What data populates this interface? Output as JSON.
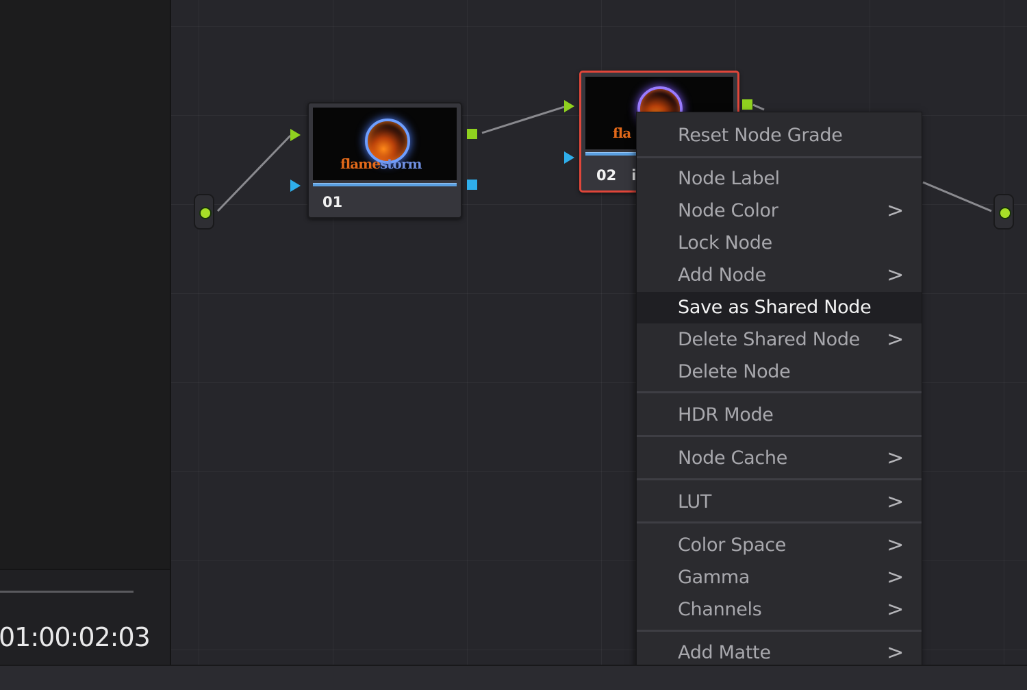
{
  "viewer": {
    "timecode": "01:00:02:03"
  },
  "nodes": [
    {
      "id": "node-01",
      "label": "01",
      "thumbnail": "flamestorm",
      "selected": false
    },
    {
      "id": "node-02",
      "label": "02",
      "thumbnail": "flamestorm",
      "selected": true,
      "label_extra": "i"
    }
  ],
  "thumbnail_text": {
    "part_a": "flame",
    "part_b": "storm",
    "partial": "fla"
  },
  "colors": {
    "accent_selected": "#e0463a",
    "port_green": "#8fd11f",
    "port_blue": "#2faeea",
    "menu_bg": "#2b2b2f",
    "menu_text": "#a8a8ad",
    "menu_highlight_text": "#f4f4f4"
  },
  "context_menu": {
    "items": [
      {
        "label": "Reset Node Grade",
        "submenu": false
      },
      {
        "label": "Node Label",
        "submenu": false
      },
      {
        "label": "Node Color",
        "submenu": true
      },
      {
        "label": "Lock Node",
        "submenu": false
      },
      {
        "label": "Add Node",
        "submenu": true
      },
      {
        "label": "Save as Shared Node",
        "submenu": false,
        "highlighted": true
      },
      {
        "label": "Delete Shared Node",
        "submenu": true
      },
      {
        "label": "Delete Node",
        "submenu": false
      },
      {
        "label": "HDR Mode",
        "submenu": false
      },
      {
        "label": "Node Cache",
        "submenu": true
      },
      {
        "label": "LUT",
        "submenu": true
      },
      {
        "label": "Color Space",
        "submenu": true
      },
      {
        "label": "Gamma",
        "submenu": true
      },
      {
        "label": "Channels",
        "submenu": true
      },
      {
        "label": "Add Matte",
        "submenu": true
      }
    ],
    "chevron_glyph": ">"
  }
}
